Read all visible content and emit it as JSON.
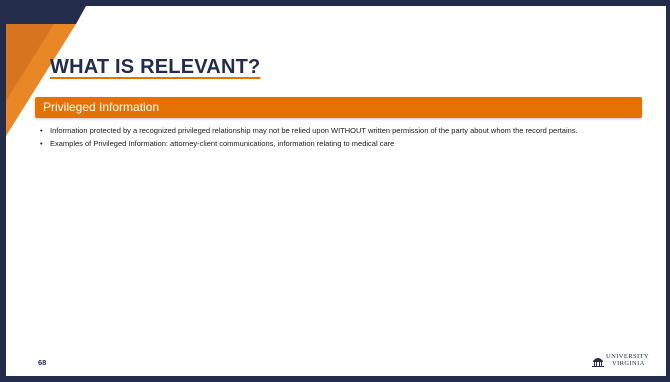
{
  "slide": {
    "title": "WHAT IS RELEVANT?",
    "banner": "Privileged Information",
    "bullets": [
      "Information protected by a recognized privileged relationship may not be relied upon WITHOUT written permission of the party about whom the record pertains.",
      "Examples of Privileged Information: attorney-client communications, information relating to medical care"
    ],
    "page_number": "68"
  },
  "logo": {
    "icon": "rotunda-icon",
    "line1": "UNIVERSITY",
    "line2": "VIRGINIA"
  },
  "colors": {
    "navy": "#232d4b",
    "orange": "#e57200",
    "background": "#ffffff"
  }
}
